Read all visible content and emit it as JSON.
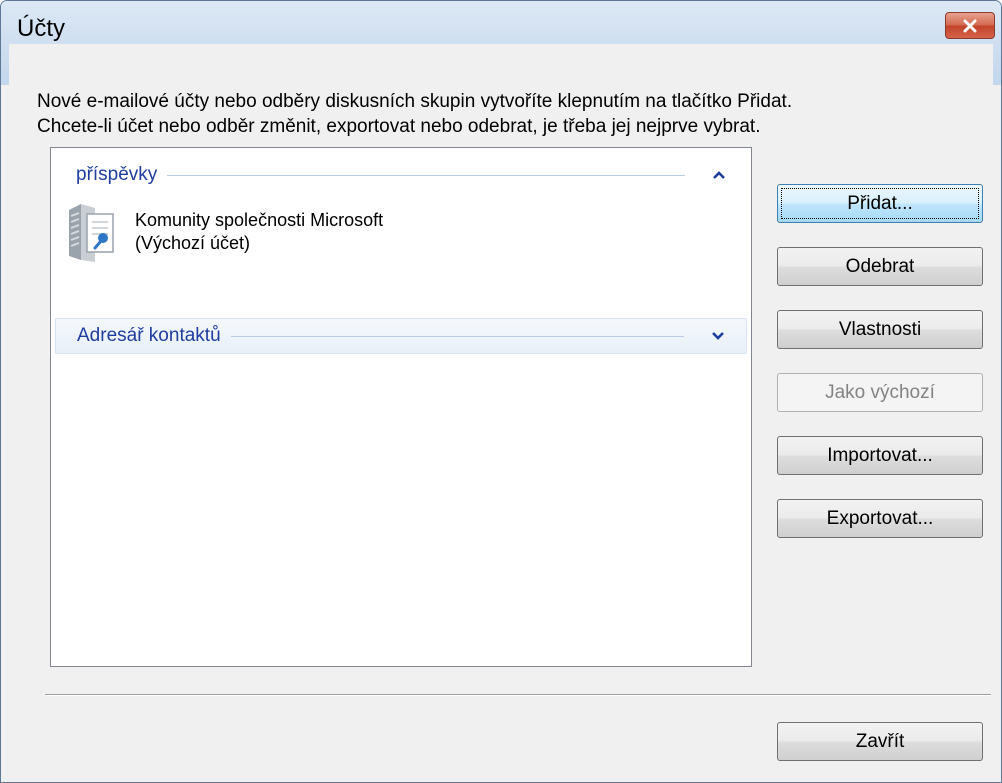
{
  "window": {
    "title": "Účty"
  },
  "description": {
    "line1": "Nové e-mailové účty nebo odběry diskusních skupin vytvoříte klepnutím na tlačítko Přidat.",
    "line2": "Chcete-li účet nebo odběr změnit, exportovat nebo odebrat, je třeba jej nejprve vybrat."
  },
  "list": {
    "groups": [
      {
        "label": "příspěvky",
        "state": "expanded",
        "items": [
          {
            "name": "Komunity společnosti Microsoft",
            "subtitle": "(Výchozí účet)",
            "icon": "news-server-icon"
          }
        ]
      },
      {
        "label": "Adresář kontaktů",
        "state": "collapsed",
        "items": []
      }
    ]
  },
  "buttons": {
    "add": "Přidat...",
    "remove": "Odebrat",
    "properties": "Vlastnosti",
    "set_default": "Jako výchozí",
    "import": "Importovat...",
    "export": "Exportovat...",
    "close": "Zavřít"
  },
  "colors": {
    "group_header_text": "#1e3d9e",
    "close_button": "#c2432a"
  }
}
